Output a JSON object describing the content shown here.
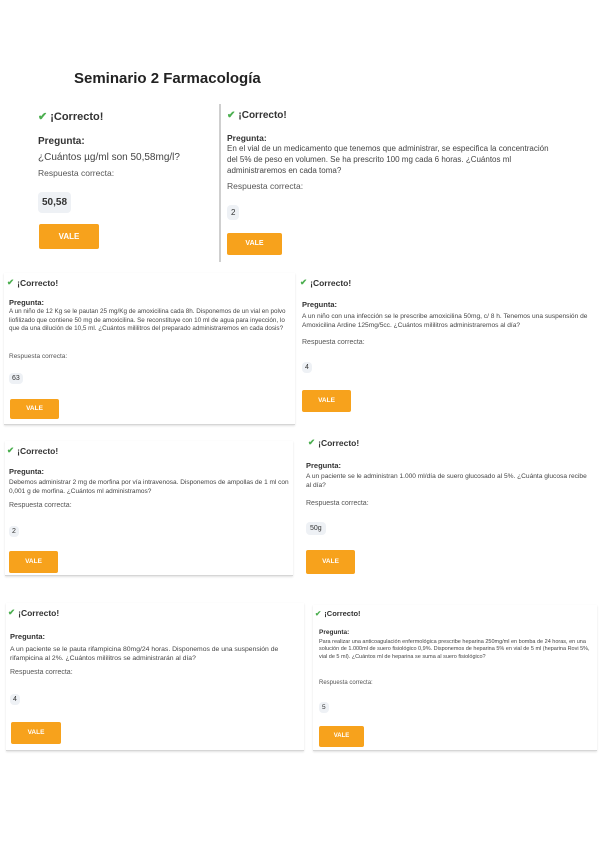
{
  "page": {
    "title": "Seminario 2 Farmacología"
  },
  "common": {
    "correct": "¡Correcto!",
    "question_label": "Pregunta:",
    "answer_label": "Respuesta correcta:",
    "ok_button": "VALE"
  },
  "colors": {
    "accent": "#f7a21c",
    "check": "#4caf50",
    "answer_bg": "#eef1f5"
  },
  "cards": [
    {
      "question": "¿Cuántos µg/ml son 50,58mg/l?",
      "answer": "50,58"
    },
    {
      "question": "En el vial de un medicamento que tenemos que administrar, se especifica la concentración del 5% de peso en volumen. Se ha prescrito 100 mg cada 6 horas. ¿Cuántos ml administraremos en cada toma?",
      "answer": "2"
    },
    {
      "question": "A un niño de 12 Kg se le pautan 25 mg/Kg de amoxicilina cada 8h. Disponemos de un vial en polvo liofilizado que contiene 50 mg de amoxicilina. Se reconstituye con 10 ml de agua para inyección, lo que da una dilución de 10,5 ml. ¿Cuántos mililitros del preparado administraremos en cada dosis?",
      "answer": "63"
    },
    {
      "question": "A un niño con una infección se le prescribe amoxicilina 50mg, c/ 8 h. Tenemos una suspensión de Amoxicilina Ardine 125mg/5cc. ¿Cuántos mililitros administraremos al día?",
      "answer": "4"
    },
    {
      "question": "Debemos administrar 2 mg de morfina por vía intravenosa. Disponemos de ampollas de 1 ml con 0,001 g de morfina. ¿Cuántos ml administramos?",
      "answer": "2"
    },
    {
      "question": "A un paciente se le administran 1.000 ml/día de suero glucosado al 5%. ¿Cuánta glucosa recibe al día?",
      "answer": "50g"
    },
    {
      "question": "A un paciente se le pauta rifampicina 80mg/24 horas. Disponemos de una suspensión de rifampicina al 2%. ¿Cuántos mililitros se administrarán al día?",
      "answer": "4"
    },
    {
      "question": "Para realizar una anticoagulación enfermológica prescribe heparina 250mg/ml en bomba de 24 horas, en una solución de 1.000ml de suero fisiológico 0,9%. Disponemos de heparina 5% en vial de 5 ml (heparina Rovi 5%, vial de 5 ml). ¿Cuántos ml de heparina se suma al suero fisiológico?",
      "answer": "5"
    }
  ]
}
